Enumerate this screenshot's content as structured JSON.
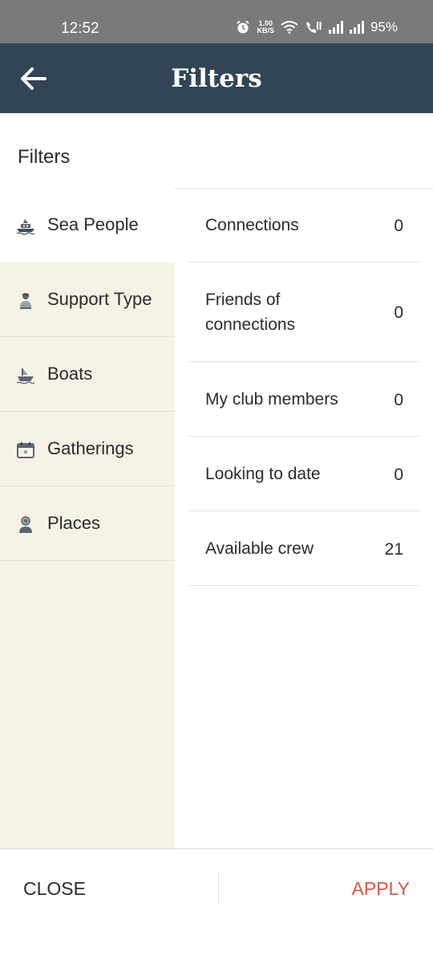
{
  "status_bar": {
    "time": "12:52",
    "speed_top": "1.00",
    "speed_bottom": "KB/S",
    "battery": "95%",
    "icons": [
      "alarm-icon",
      "wifi-icon",
      "call-icon",
      "signal-icon",
      "signal-icon",
      "battery-icon"
    ]
  },
  "app_bar": {
    "title": "Filters",
    "back_icon": "arrow-left-icon",
    "background": "#314556"
  },
  "header": {
    "label": "Filters"
  },
  "categories": [
    {
      "label": "Sea People",
      "icon": "sea-people-icon",
      "active": true
    },
    {
      "label": "Support Type",
      "icon": "support-type-icon",
      "active": false
    },
    {
      "label": "Boats",
      "icon": "boat-icon",
      "active": false
    },
    {
      "label": "Gatherings",
      "icon": "calendar-icon",
      "active": false
    },
    {
      "label": "Places",
      "icon": "place-icon",
      "active": false
    }
  ],
  "options": [
    {
      "label": "Connections",
      "count": "0"
    },
    {
      "label": "Friends of connections",
      "count": "0"
    },
    {
      "label": "My club members",
      "count": "0"
    },
    {
      "label": "Looking to date",
      "count": "0"
    },
    {
      "label": "Available crew",
      "count": "21"
    }
  ],
  "bottom_bar": {
    "close_label": "CLOSE",
    "apply_label": "APPLY",
    "apply_color": "#d9573f"
  }
}
